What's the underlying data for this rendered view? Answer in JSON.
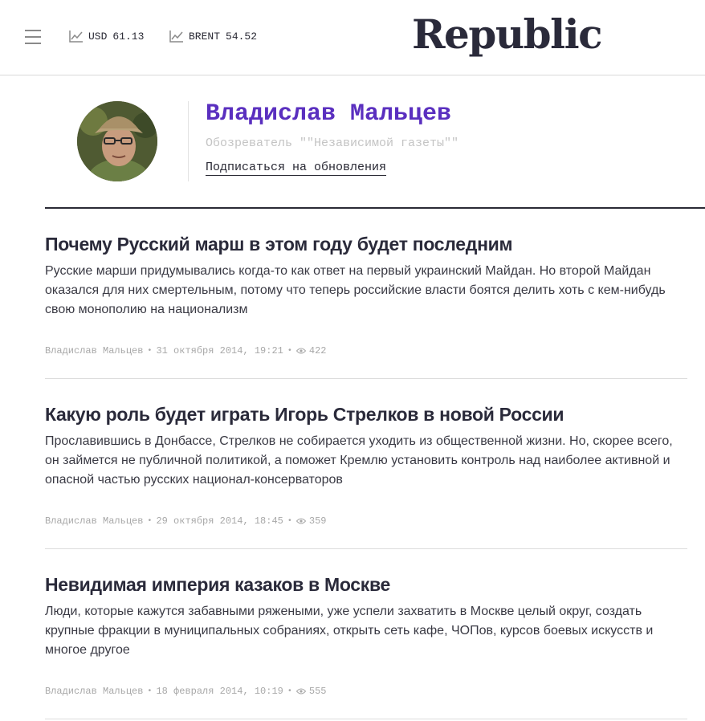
{
  "header": {
    "tickers": [
      {
        "label": "USD",
        "value": "61.13"
      },
      {
        "label": "BRENT",
        "value": "54.52"
      }
    ],
    "logo": "Republic"
  },
  "author": {
    "name": "Владислав Мальцев",
    "role": "Обозреватель \"\"Независимой газеты\"\"",
    "subscribe_label": "Подписаться на обновления"
  },
  "articles": [
    {
      "title": "Почему Русский марш в этом году будет последним",
      "lead": "Русские марши придумывались когда-то как ответ на первый украинский Майдан. Но второй Майдан оказался для них смертельным, потому что теперь российские власти боятся делить хоть с кем-нибудь свою монополию на национализм",
      "author": "Владислав Мальцев",
      "date": "31 октября 2014, 19:21",
      "views": "422"
    },
    {
      "title": "Какую роль будет играть Игорь Стрелков в новой России",
      "lead": "Прославившись в Донбассе, Стрелков не собирается уходить из общественной жизни. Но, скорее всего, он займется не публичной политикой, а поможет Кремлю установить контроль над наиболее активной и опасной частью русских национал-консерваторов",
      "author": "Владислав Мальцев",
      "date": "29 октября 2014, 18:45",
      "views": "359"
    },
    {
      "title": "Невидимая империя казаков в Москве",
      "lead": "Люди, которые кажутся забавными ряжеными, уже успели захватить в Москве целый округ, создать крупные фракции в муниципальных собраниях, открыть сеть кафе, ЧОПов, курсов боевых искусств и многое другое",
      "author": "Владислав Мальцев",
      "date": "18 февраля 2014, 10:19",
      "views": "555"
    }
  ]
}
